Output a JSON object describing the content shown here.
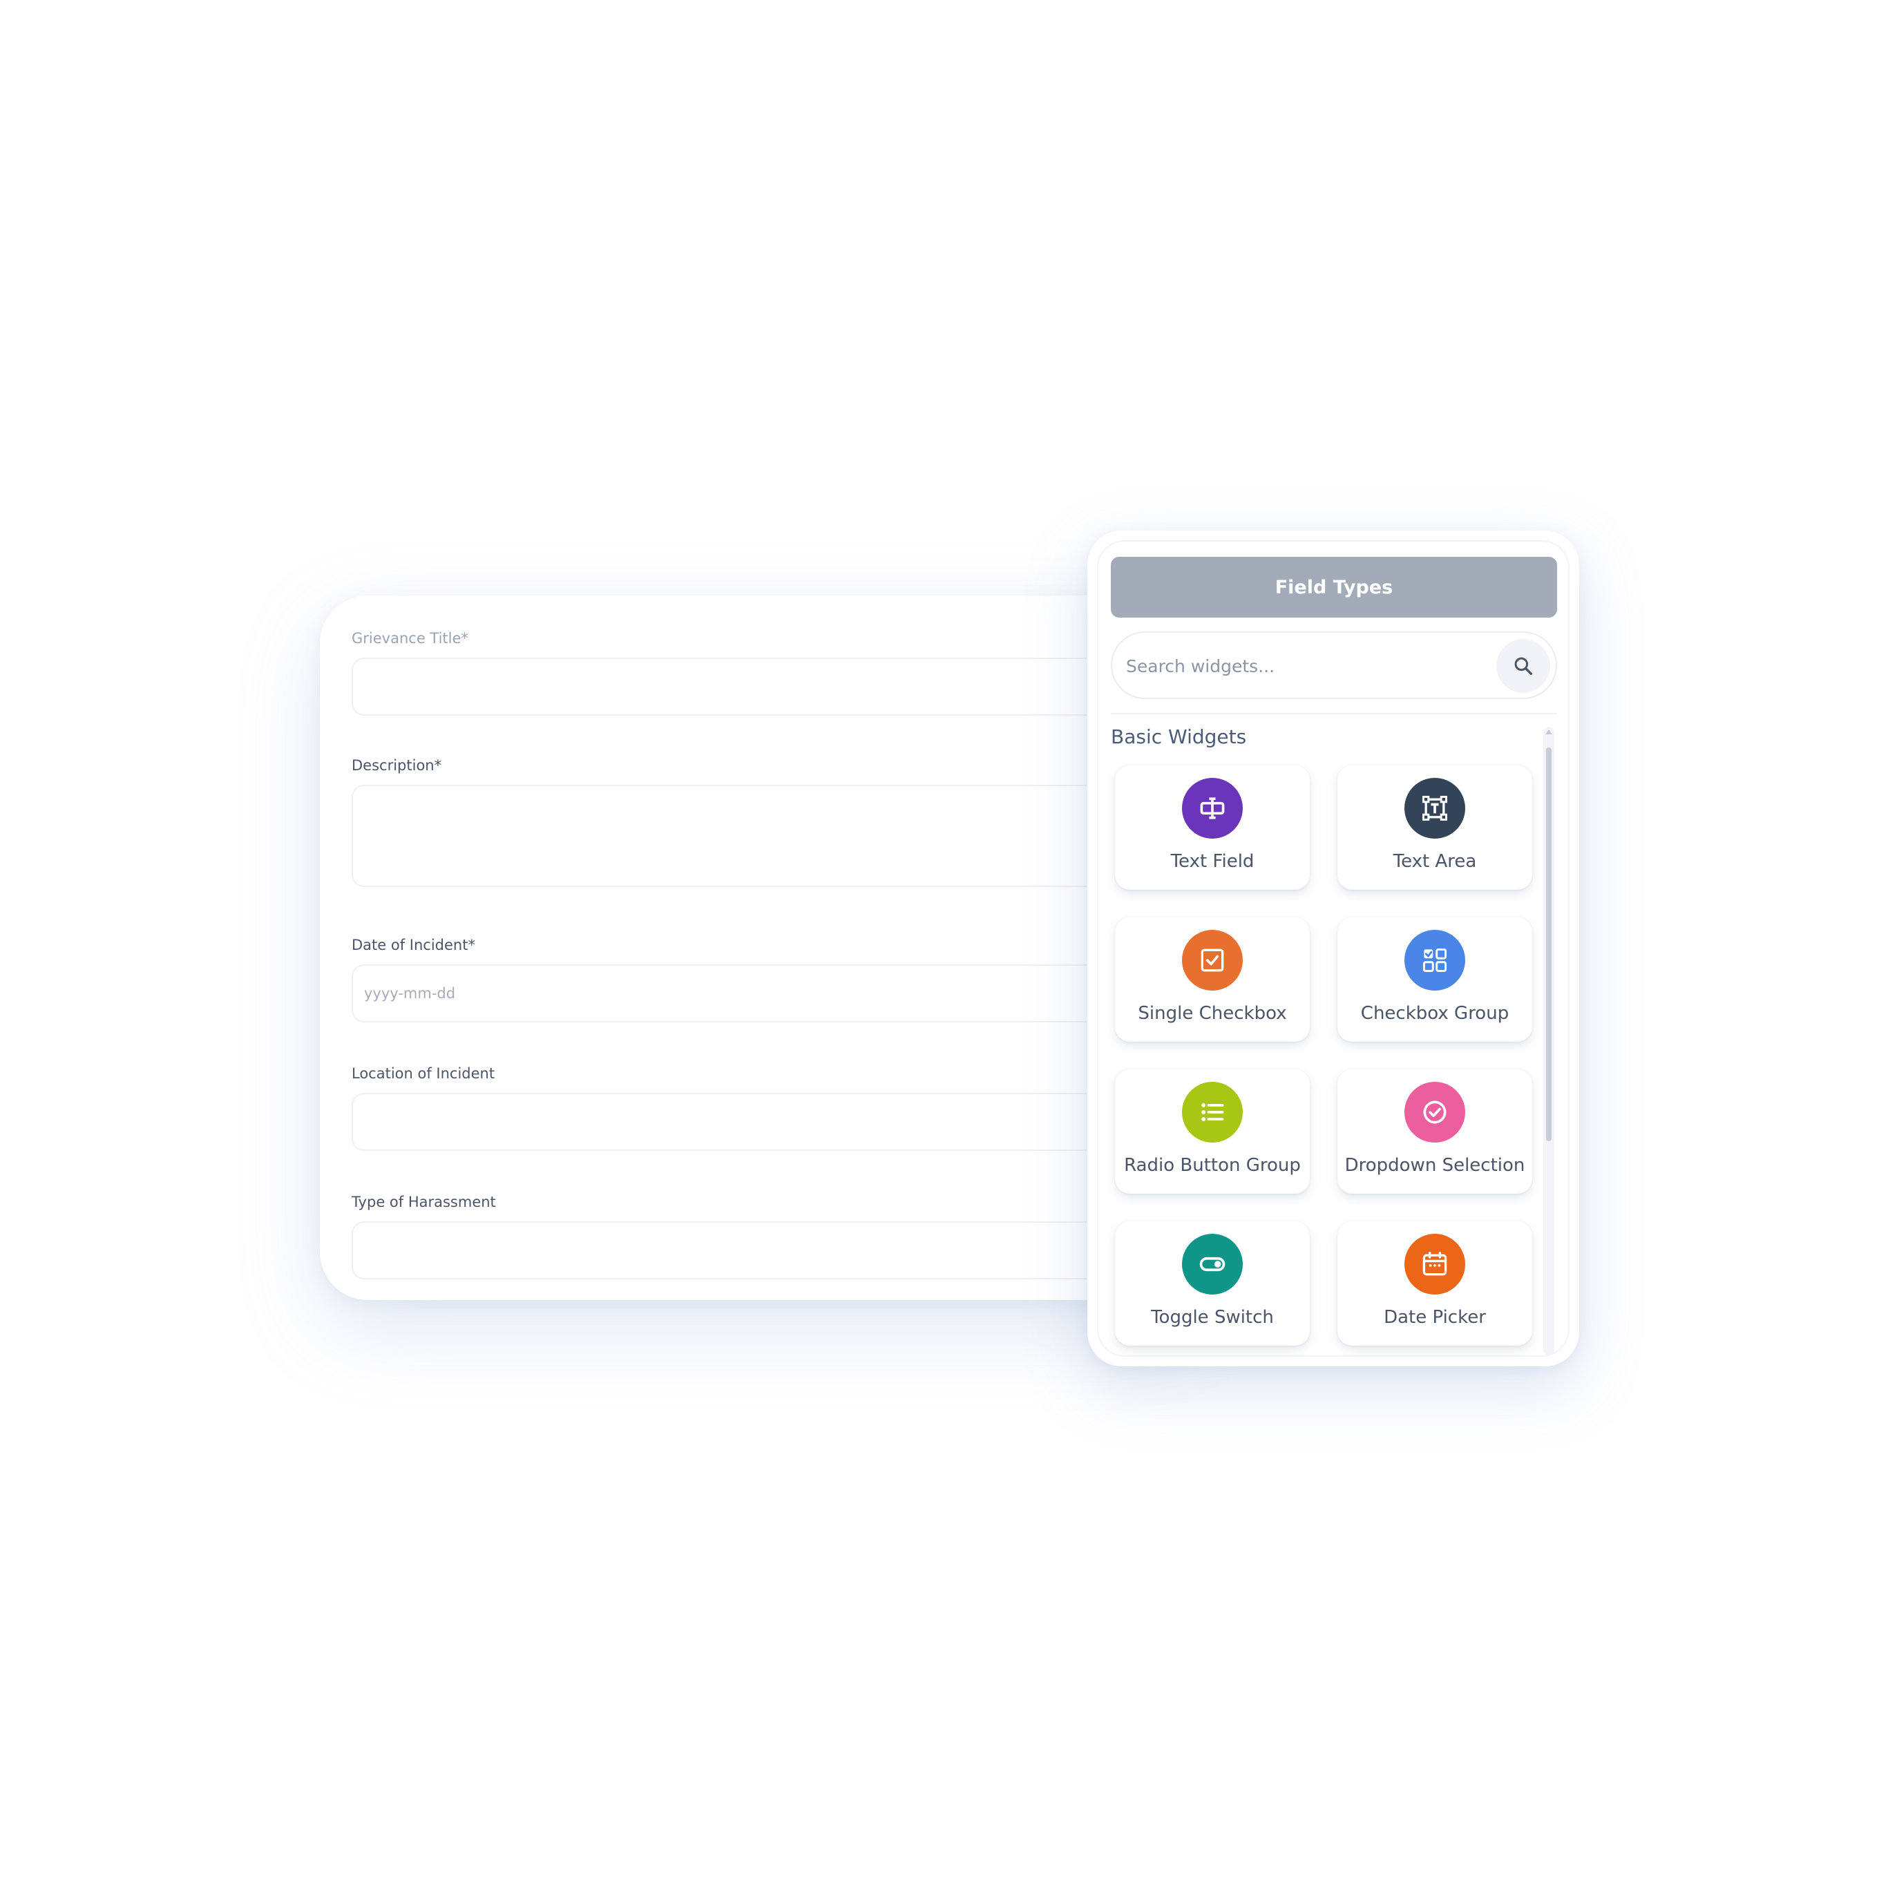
{
  "form": {
    "fields": [
      {
        "label": "Grievance Title*",
        "placeholder": ""
      },
      {
        "label": "Description*",
        "placeholder": ""
      },
      {
        "label": "Date of Incident*",
        "placeholder": "yyyy-mm-dd"
      },
      {
        "label": "Location of Incident",
        "placeholder": ""
      },
      {
        "label": "Type of Harassment",
        "placeholder": ""
      }
    ]
  },
  "panel": {
    "title": "Field Types",
    "search": {
      "placeholder": "Search widgets...",
      "value": ""
    },
    "section_title": "Basic Widgets",
    "widgets": [
      {
        "label": "Text Field",
        "icon": "text-field-icon",
        "color": "#6a35b8"
      },
      {
        "label": "Text Area",
        "icon": "text-area-icon",
        "color": "#334459"
      },
      {
        "label": "Single Checkbox",
        "icon": "checkbox-icon",
        "color": "#e8702f"
      },
      {
        "label": "Checkbox Group",
        "icon": "checkbox-group-icon",
        "color": "#4a86e8"
      },
      {
        "label": "Radio Button Group",
        "icon": "list-icon",
        "color": "#a8c614"
      },
      {
        "label": "Dropdown Selection",
        "icon": "check-circle-icon",
        "color": "#ec5f9f"
      },
      {
        "label": "Toggle Switch",
        "icon": "toggle-icon",
        "color": "#0f9688"
      },
      {
        "label": "Date Picker",
        "icon": "calendar-icon",
        "color": "#ec6618"
      }
    ]
  }
}
